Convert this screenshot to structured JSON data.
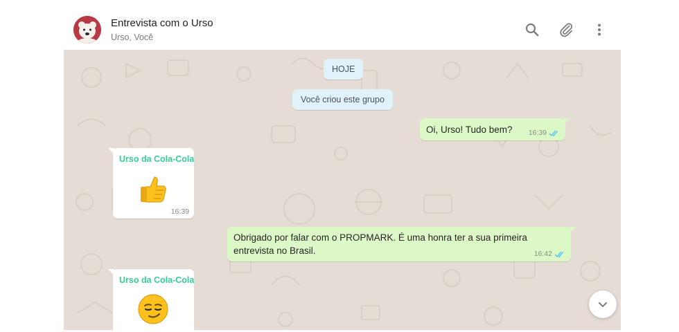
{
  "header": {
    "title": "Entrevista com o Urso",
    "subtitle": "Urso, Você",
    "avatar_icon": "polar-bear-avatar",
    "icons": [
      "search-icon",
      "attach-icon",
      "menu-icon"
    ]
  },
  "colors": {
    "chat_background": "#e5ddd5",
    "outgoing_bubble": "#dcf8c6",
    "incoming_bubble": "#ffffff",
    "system_bubble": "#e1f2fa",
    "sender_name": "#35cd96",
    "read_ticks": "#4fc3f7"
  },
  "chat": {
    "date_label": "HOJE",
    "system_message": "Você criou este grupo",
    "messages": [
      {
        "direction": "out",
        "text": "Oi, Urso! Tudo bem?",
        "time": "16:39",
        "status": "read"
      },
      {
        "direction": "in",
        "sender": "Urso da Cola-Cola",
        "emoji": "thumbs-up-emoji",
        "time": "16:39"
      },
      {
        "direction": "out",
        "text": "Obrigado por falar com o PROPMARK. É uma honra ter a sua primeira entrevista no Brasil.",
        "time": "16:42",
        "status": "read"
      },
      {
        "direction": "in",
        "sender": "Urso da Cola-Cola",
        "emoji": "smirking-face-emoji"
      }
    ]
  },
  "scroll_button_icon": "chevron-down-icon"
}
